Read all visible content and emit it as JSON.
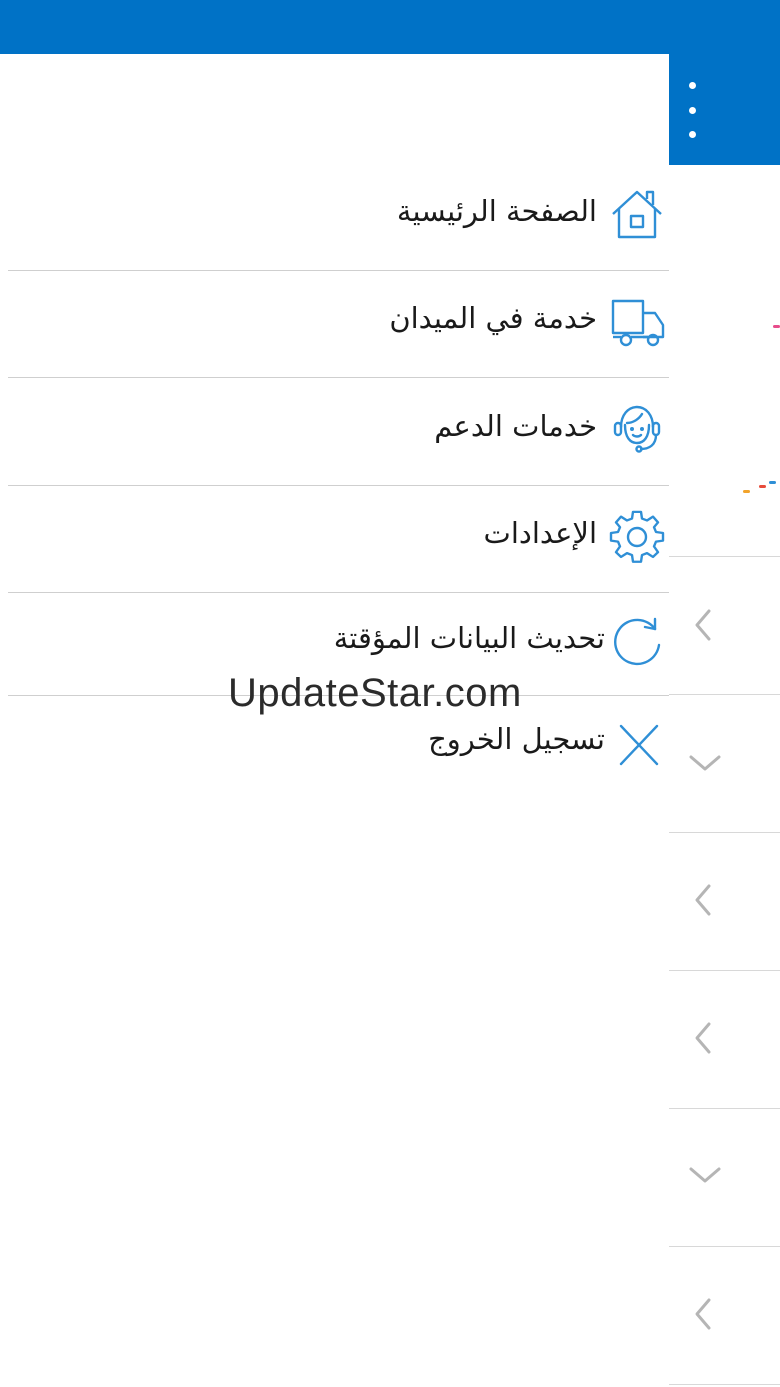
{
  "theme": {
    "accent": "#0072c6",
    "icon_color": "#2f8fd6"
  },
  "header": {
    "more_icon": "more-vertical-icon"
  },
  "drawer": {
    "items": [
      {
        "label": "الصفحة الرئيسية",
        "icon": "home-icon"
      },
      {
        "label": "خدمة في الميدان",
        "icon": "truck-icon"
      },
      {
        "label": "خدمات الدعم",
        "icon": "headset-support-icon"
      },
      {
        "label": "الإعدادات",
        "icon": "gear-icon"
      },
      {
        "label": "تحديث البيانات المؤقتة",
        "icon": "refresh-icon"
      },
      {
        "label": "تسجيل الخروج",
        "icon": "close-icon"
      }
    ]
  },
  "background_list": {
    "chevrons": [
      "chevron-left-icon",
      "chevron-down-icon",
      "chevron-left-icon",
      "chevron-left-icon",
      "chevron-down-icon",
      "chevron-left-icon"
    ]
  },
  "watermark": "UpdateStar.com"
}
